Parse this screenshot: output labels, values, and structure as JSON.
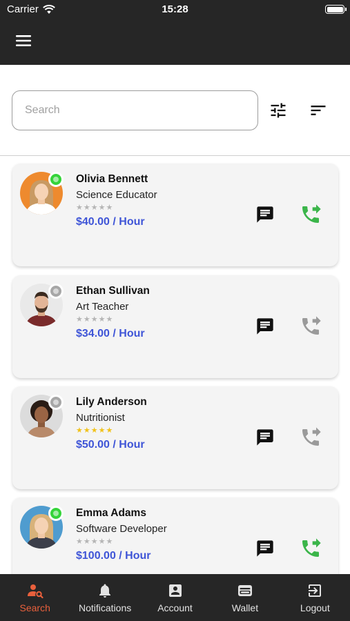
{
  "status_bar": {
    "carrier": "Carrier",
    "time": "15:28"
  },
  "search": {
    "placeholder": "Search",
    "value": ""
  },
  "tutors": [
    {
      "name": "Olivia Bennett",
      "role": "Science Educator",
      "price": "$40.00 / Hour",
      "rating": 0,
      "online": true,
      "call_color": "#3bb54a",
      "avatar": "woman-orange-bg"
    },
    {
      "name": "Ethan Sullivan",
      "role": "Art Teacher",
      "price": "$34.00 / Hour",
      "rating": 0,
      "online": false,
      "call_color": "#9a9a9a",
      "avatar": "man-beard"
    },
    {
      "name": "Lily Anderson",
      "role": "Nutritionist",
      "price": "$50.00 / Hour",
      "rating": 5,
      "online": false,
      "call_color": "#9a9a9a",
      "avatar": "woman-curly"
    },
    {
      "name": "Emma Adams",
      "role": "Software Developer",
      "price": "$100.00 / Hour",
      "rating": 0,
      "online": true,
      "call_color": "#3bb54a",
      "avatar": "woman-blue-bg"
    }
  ],
  "tabs": [
    {
      "label": "Search",
      "icon": "user-search-icon",
      "active": true
    },
    {
      "label": "Notifications",
      "icon": "bell-icon",
      "active": false
    },
    {
      "label": "Account",
      "icon": "account-box-icon",
      "active": false
    },
    {
      "label": "Wallet",
      "icon": "wallet-icon",
      "active": false
    },
    {
      "label": "Logout",
      "icon": "logout-icon",
      "active": false
    }
  ],
  "colors": {
    "accent": "#e9603c",
    "price": "#3f55d7",
    "online": "#35d43a",
    "bar": "#262626"
  }
}
